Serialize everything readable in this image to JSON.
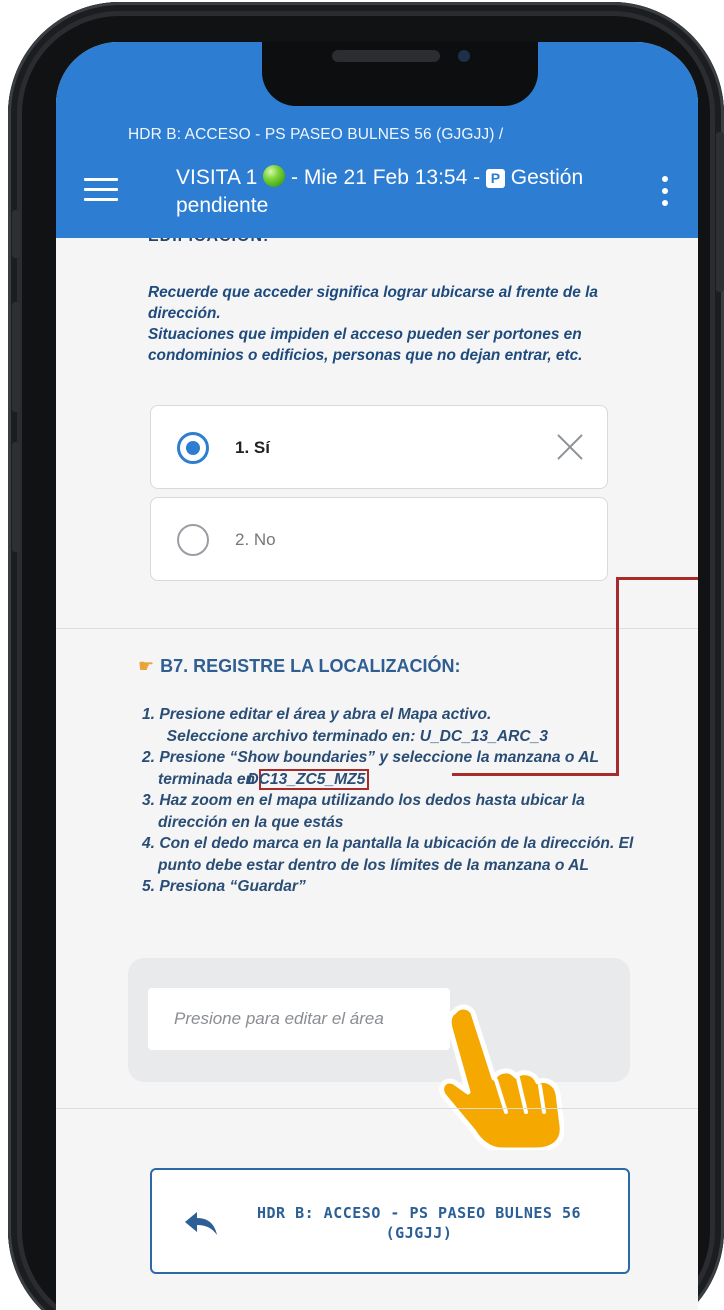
{
  "appbar": {
    "breadcrumb": "HDR B: ACCESO - PS PASEO BULNES 56 (GJGJJ) /",
    "visit_label": "VISITA 1",
    "date_text": "- Mie 21 Feb 13:54 -",
    "status_badge": "P",
    "status_text": "Gestión pendiente",
    "status_dot_color": "#5cc127"
  },
  "section_a": {
    "cut_heading": "EDIFICACIÓN:",
    "note_lines": [
      "Recuerde que acceder significa lograr ubicarse al frente de la dirección.",
      "Situaciones que impiden el acceso pueden ser portones en condominios o edificios, personas que no dejan entrar, etc."
    ],
    "options": [
      {
        "label": "1. Sí",
        "selected": true
      },
      {
        "label": "2. No",
        "selected": false
      }
    ]
  },
  "section_b7": {
    "title": "B7. REGISTRE LA LOCALIZACIÓN:",
    "steps": {
      "s1_a": "1. Presione editar el área y abra el Mapa activo.",
      "s1_b": "Seleccione archivo terminado en: U_DC_13_ARC_3",
      "s2_a": "2. Presione “Show boundaries” y seleccione la manzana o AL terminada en",
      "s2_code": "DC13_ZC5_MZ5",
      "s3": "3. Haz zoom en el mapa utilizando los dedos hasta ubicar la dirección en la que estás",
      "s4": "4. Con el dedo marca en la pantalla la ubicación de la dirección. El punto debe estar dentro de los límites de la manzana o AL",
      "s5": "5. Presiona “Guardar”"
    },
    "map_input_placeholder": "Presione para editar el área"
  },
  "back_button": {
    "label": "HDR B: ACCESO - PS PASEO BULNES 56 (GJGJJ)"
  },
  "colors": {
    "appbar": "#2d7dd2",
    "accent": "#2d7dd2",
    "highlight": "#a72b2b",
    "pointer": "#f5a800"
  }
}
